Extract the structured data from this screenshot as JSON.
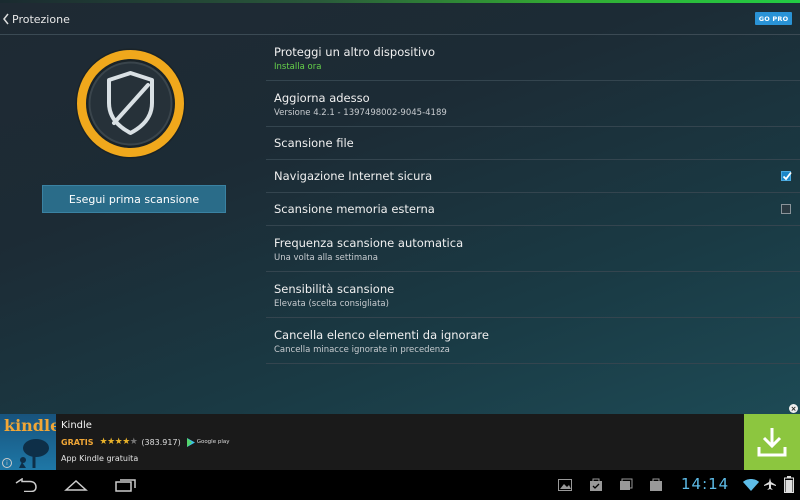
{
  "header": {
    "title": "Protezione",
    "go_pro_label": "GO PRO"
  },
  "scan_button_label": "Esegui prima scansione",
  "settings": [
    {
      "title": "Proteggi un altro dispositivo",
      "subtitle": "Installa ora"
    },
    {
      "title": "Aggiorna adesso",
      "subtitle": "Versione 4.2.1 - 1397498002-9045-4189"
    },
    {
      "title": "Scansione file"
    },
    {
      "title": "Navigazione Internet sicura",
      "checked": true
    },
    {
      "title": "Scansione memoria esterna",
      "checked": false
    },
    {
      "title": "Frequenza scansione automatica",
      "subtitle": "Una volta alla settimana"
    },
    {
      "title": "Sensibilità scansione",
      "subtitle": "Elevata (scelta consigliata)"
    },
    {
      "title": "Cancella elenco elementi da ignorare",
      "subtitle": "Cancella minacce ignorate in precedenza"
    }
  ],
  "ad": {
    "logo_text": "kindle",
    "name": "Kindle",
    "price": "GRATIS",
    "rating": 4,
    "rating_count": "(383.917)",
    "store_label": "Google play",
    "description": "App Kindle gratuita",
    "info_label": "i",
    "close_label": "×"
  },
  "status_bar": {
    "time": "14:14"
  },
  "colors": {
    "accent_blue": "#2a93d6",
    "installa_green": "#66d14a",
    "shield_ring": "#f0a81c",
    "download_green": "#8cc63f",
    "clock_blue": "#5dbce8"
  },
  "icons": {
    "back": "chevron-left-icon",
    "shield": "shield-icon",
    "download": "download-icon",
    "navbar": [
      "back-nav-icon",
      "home-nav-icon",
      "recent-apps-icon"
    ],
    "notifications": [
      "gallery-icon",
      "shopping-bag-icon",
      "photos-icon",
      "store-icon"
    ],
    "status": [
      "wifi-icon",
      "airplane-icon",
      "battery-icon"
    ]
  }
}
